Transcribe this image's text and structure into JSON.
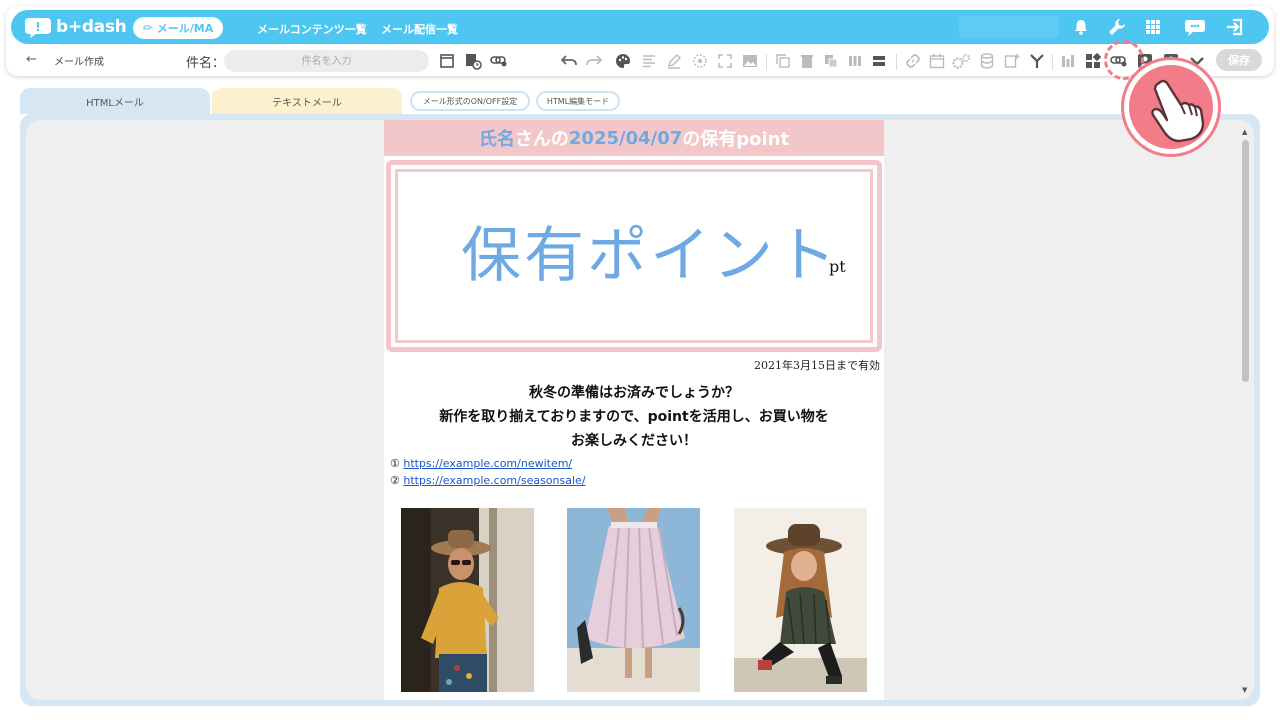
{
  "app": {
    "logo_text": "b+dash",
    "nav_pill_label": "メール/MA",
    "nav_links": [
      "メールコンテンツ一覧",
      "メール配信一覧"
    ]
  },
  "toolbar": {
    "back_label": "メール作成",
    "subject_label": "件名：",
    "subject_placeholder": "件名を入力",
    "save_label": "保存"
  },
  "tabs": {
    "html_mail": "HTMLメール",
    "text_mail": "テキストメール",
    "toggle_button": "メール形式のON/OFF設定",
    "html_edit_button": "HTML編集モード"
  },
  "email": {
    "header_name": "氏名",
    "header_mid": "さんの",
    "header_date": "2025/04/07",
    "header_tail": "の保有point",
    "points_text": "保有ポイント",
    "points_unit": "pt",
    "valid_until": "2021年3月15日まで有効",
    "message_lines": [
      "秋冬の準備はお済みでしょうか？",
      "新作を取り揃えておりますので、pointを活用し、お買い物を",
      "お楽しみください！"
    ],
    "links": [
      {
        "num": "①",
        "url": "https://example.com/newitem/"
      },
      {
        "num": "②",
        "url": "https://example.com/seasonsale/"
      }
    ]
  },
  "colors": {
    "brand": "#4dc6f2",
    "pink": "#f3c7c9",
    "blue_text": "#6fa9e4",
    "tab_html": "#d6e6f3",
    "tab_text": "#fbf1cf",
    "pointer": "#f27c88"
  },
  "icons": {
    "nav": [
      "bell-icon",
      "wrench-icon",
      "grid-apps-icon",
      "support-chat-icon",
      "logout-icon"
    ],
    "toolbar": [
      "template-icon",
      "schedule-icon",
      "link-settings-icon",
      "undo-icon",
      "redo-icon",
      "palette-icon",
      "align-icon",
      "pen-icon",
      "target-icon",
      "fullscreen-icon",
      "image-icon",
      "copy-icon",
      "trash-icon",
      "duplicate-icon",
      "columns-icon",
      "rows-icon",
      "link-icon",
      "calendar-icon",
      "gears-icon",
      "database-icon",
      "add-doc-icon",
      "branch-icon",
      "chart-icon",
      "puzzle-icon",
      "link-settings-icon",
      "person-icon",
      "user-icon",
      "chevron-down-icon"
    ]
  }
}
